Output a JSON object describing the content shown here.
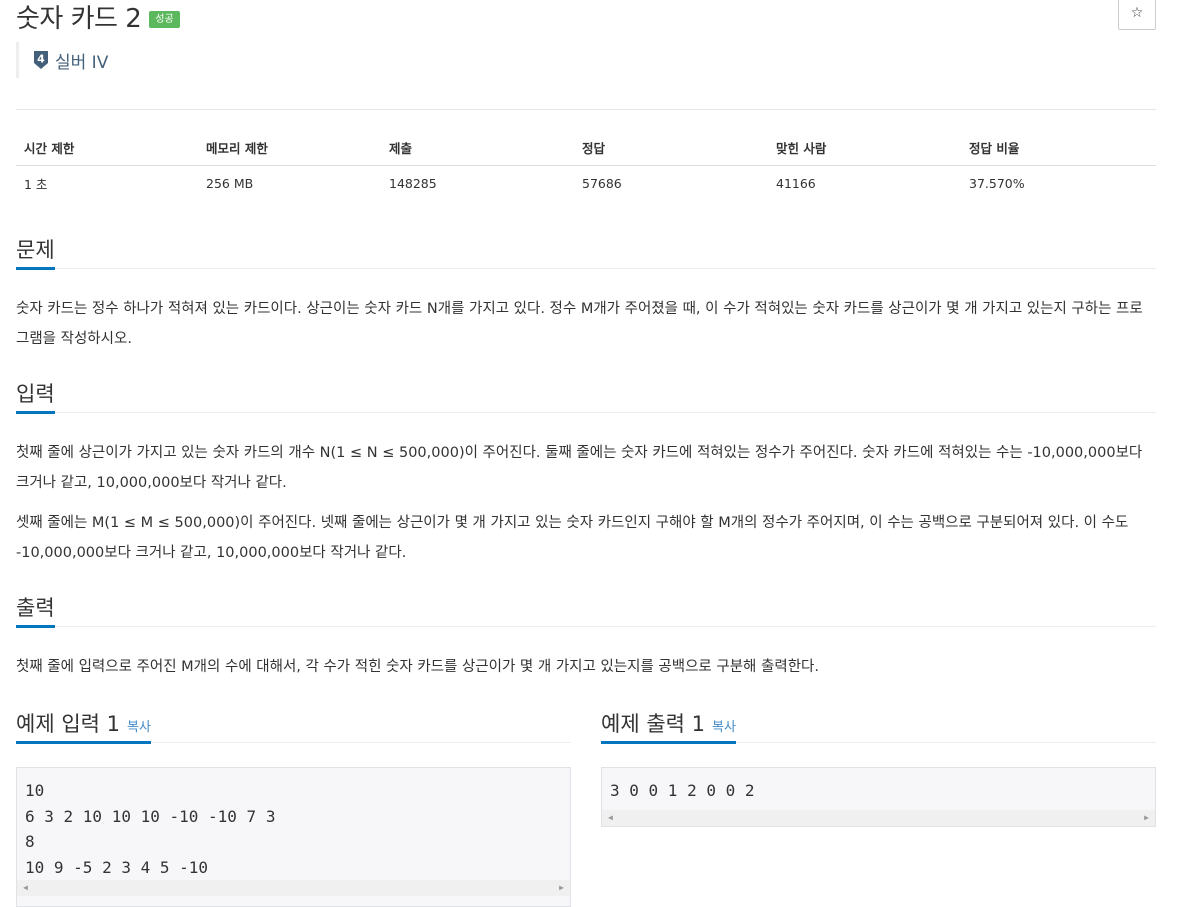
{
  "problem": {
    "title": "숫자 카드 2",
    "status_badge": "성공",
    "star_icon": "☆",
    "tier": {
      "number": "4",
      "label": "실버 IV",
      "color": "#435f7a"
    }
  },
  "info_table": {
    "headers": [
      "시간 제한",
      "메모리 제한",
      "제출",
      "정답",
      "맞힌 사람",
      "정답 비율"
    ],
    "values": [
      "1 초",
      "256 MB",
      "148285",
      "57686",
      "41166",
      "37.570%"
    ]
  },
  "sections": {
    "problem": {
      "title": "문제",
      "text": "숫자 카드는 정수 하나가 적혀져 있는 카드이다. 상근이는 숫자 카드 N개를 가지고 있다. 정수 M개가 주어졌을 때, 이 수가 적혀있는 숫자 카드를 상근이가 몇 개 가지고 있는지 구하는 프로그램을 작성하시오."
    },
    "input": {
      "title": "입력",
      "text1": "첫째 줄에 상근이가 가지고 있는 숫자 카드의 개수 N(1 ≤ N ≤ 500,000)이 주어진다. 둘째 줄에는 숫자 카드에 적혀있는 정수가 주어진다. 숫자 카드에 적혀있는 수는 -10,000,000보다 크거나 같고, 10,000,000보다 작거나 같다.",
      "text2": "셋째 줄에는 M(1 ≤ M ≤ 500,000)이 주어진다. 넷째 줄에는 상근이가 몇 개 가지고 있는 숫자 카드인지 구해야 할 M개의 정수가 주어지며, 이 수는 공백으로 구분되어져 있다. 이 수도 -10,000,000보다 크거나 같고, 10,000,000보다 작거나 같다."
    },
    "output": {
      "title": "출력",
      "text": "첫째 줄에 입력으로 주어진 M개의 수에 대해서, 각 수가 적힌 숫자 카드를 상근이가 몇 개 가지고 있는지를 공백으로 구분해 출력한다."
    }
  },
  "samples": {
    "input": {
      "title": "예제 입력 1",
      "copy": "복사",
      "content": "10\n6 3 2 10 10 10 -10 -10 7 3\n8\n10 9 -5 2 3 4 5 -10"
    },
    "output": {
      "title": "예제 출력 1",
      "copy": "복사",
      "content": "3 0 0 1 2 0 0 2"
    }
  },
  "colors": {
    "accent": "#0076c0",
    "success": "#5cb85c",
    "link": "#428bca"
  }
}
